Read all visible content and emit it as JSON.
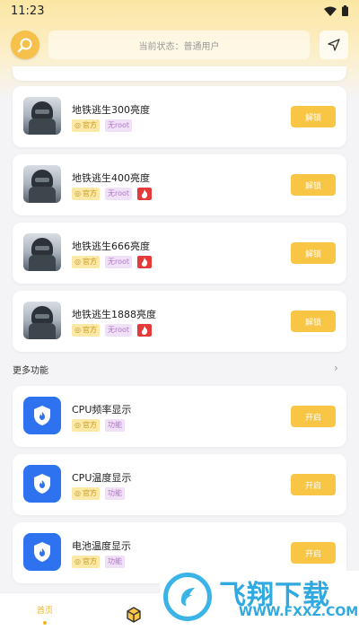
{
  "status_bar": {
    "time": "11:23"
  },
  "header": {
    "status_text": "当前状态：普通用户"
  },
  "game_items": [
    {
      "title": "地铁逃生300亮度",
      "tag1": "官方",
      "tag2": "无root",
      "hot": false,
      "button": "解锁"
    },
    {
      "title": "地铁逃生400亮度",
      "tag1": "官方",
      "tag2": "无root",
      "hot": true,
      "button": "解锁"
    },
    {
      "title": "地铁逃生666亮度",
      "tag1": "官方",
      "tag2": "无root",
      "hot": true,
      "button": "解锁"
    },
    {
      "title": "地铁逃生1888亮度",
      "tag1": "官方",
      "tag2": "无root",
      "hot": true,
      "button": "解锁"
    }
  ],
  "more_section": {
    "title": "更多功能",
    "arrow": "›"
  },
  "feature_items": [
    {
      "title": "CPU频率显示",
      "tag1": "官方",
      "tag2": "功能",
      "button": "开启"
    },
    {
      "title": "CPU温度显示",
      "tag1": "官方",
      "tag2": "功能",
      "button": "开启"
    },
    {
      "title": "电池温度显示",
      "tag1": "官方",
      "tag2": "功能",
      "button": "开启"
    }
  ],
  "tab_bar": {
    "home_label": "首页"
  },
  "watermark": {
    "brand": "飞翔下载",
    "url": "WWW.FXXZ.COM"
  },
  "colors": {
    "accent": "#f8c545",
    "hot": "#e53a3a",
    "shield": "#2f72f0"
  },
  "icons": [
    "wifi-icon",
    "battery-icon",
    "logo-icon",
    "send-icon",
    "game-thumbnail-icon",
    "shield-icon",
    "fire-icon",
    "box-icon"
  ]
}
